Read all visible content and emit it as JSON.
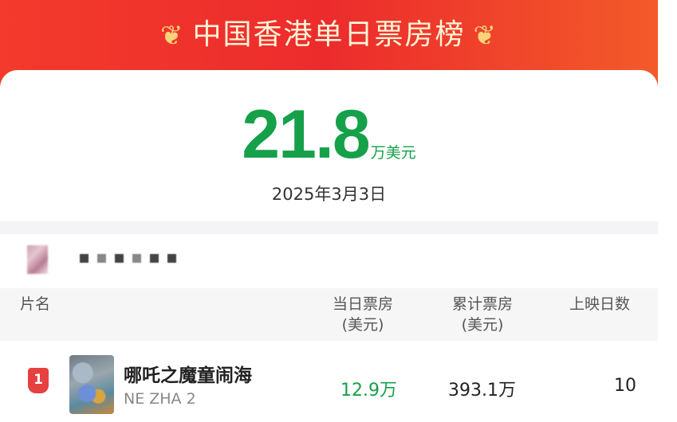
{
  "header": {
    "title": "中国香港单日票房榜",
    "laurel_left": "❦",
    "laurel_right": "❦"
  },
  "summary": {
    "amount": "21.8",
    "unit": "万美元",
    "date": "2025年3月3日"
  },
  "table": {
    "headers": {
      "film": "片名",
      "daily": "当日票房",
      "daily_unit": "(美元)",
      "total": "累计票房",
      "total_unit": "(美元)",
      "days": "上映日数"
    },
    "rows": [
      {
        "rank": "1",
        "title_cn": "哪吒之魔童闹海",
        "title_en": "NE ZHA 2",
        "daily": "12.9万",
        "total": "393.1万",
        "days": "10"
      }
    ]
  },
  "colors": {
    "header_red": "#ec2c2c",
    "accent_green": "#16a04a",
    "rank_red": "#e64040"
  }
}
